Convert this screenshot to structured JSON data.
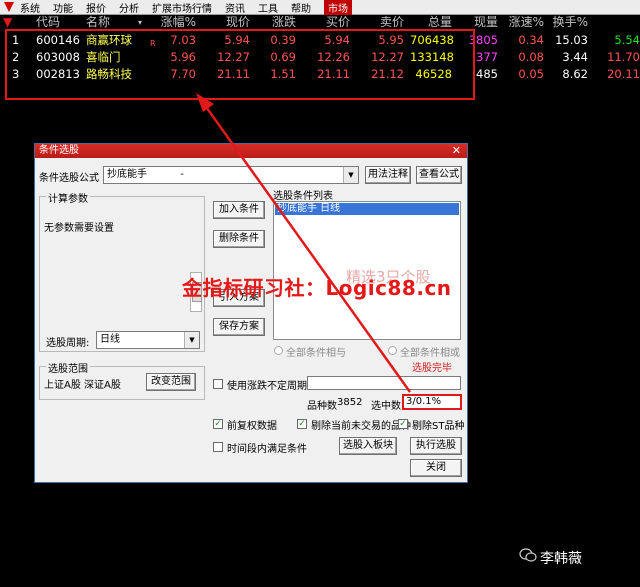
{
  "menubar": {
    "items": [
      "系统",
      "功能",
      "报价",
      "分析",
      "扩展市场行情",
      "资讯",
      "工具",
      "帮助",
      "市场"
    ],
    "active": "市场"
  },
  "quote": {
    "headers": {
      "code": "代码",
      "name": "名称",
      "change_pct": "涨幅%",
      "price": "现价",
      "change": "涨跌",
      "bid": "买价",
      "ask": "卖价",
      "volume": "总量",
      "cur_vol": "现量",
      "speed": "涨速%",
      "turnover": "换手%",
      "extra": ""
    },
    "rows": [
      {
        "idx": "1",
        "code": "600146",
        "name": "商赢环球",
        "flag": "R",
        "change_pct": "7.03",
        "price": "5.94",
        "change": "0.39",
        "bid": "5.94",
        "ask": "5.95",
        "volume": "706438",
        "cur_vol": "3805",
        "speed": "0.34",
        "turnover": "15.03",
        "extra": "5.54"
      },
      {
        "idx": "2",
        "code": "603008",
        "name": "喜临门",
        "flag": "",
        "change_pct": "5.96",
        "price": "12.27",
        "change": "0.69",
        "bid": "12.26",
        "ask": "12.27",
        "volume": "133148",
        "cur_vol": "377",
        "speed": "0.08",
        "turnover": "3.44",
        "extra": "11.70"
      },
      {
        "idx": "3",
        "code": "002813",
        "name": "路畅科技",
        "flag": "",
        "change_pct": "7.70",
        "price": "21.11",
        "change": "1.51",
        "bid": "21.11",
        "ask": "21.12",
        "volume": "46528",
        "cur_vol": "485",
        "speed": "0.05",
        "turnover": "8.62",
        "extra": "20.11"
      }
    ]
  },
  "dialog": {
    "title": "条件选股",
    "formula_label": "条件选股公式",
    "formula_value": "抄底能手",
    "formula_suffix": "-",
    "btn_usage": "用法注释",
    "btn_view_formula": "查看公式",
    "calc_params_title": "计算参数",
    "no_params": "无参数需要设置",
    "period_label": "选股周期:",
    "period_value": "日线",
    "range_title": "选股范围",
    "range_value": "上证A股  深证A股",
    "btn_change_range": "改变范围",
    "btn_add": "加入条件",
    "btn_delete": "删除条件",
    "btn_import": "引入方案",
    "btn_save": "保存方案",
    "list_title": "选股条件列表",
    "list_items": [
      "抄底能手  日线"
    ],
    "radio_and": "全部条件相与",
    "radio_or": "全部条件相或",
    "status": "选股完毕",
    "use_period_label": "使用涨跌不定周期",
    "count_label": "品种数",
    "count_value": "3852",
    "selected_label": "选中数",
    "selected_value": "3/0.1%",
    "chk_restore": "前复权数据",
    "chk_exclude_untraded": "剔除当前未交易的品种",
    "chk_exclude_st": "剔除ST品种",
    "chk_time_cond": "时间段内满足条件",
    "btn_to_block": "选股入板块",
    "btn_execute": "执行选股",
    "btn_close": "关闭"
  },
  "watermark_list": "精选3只个股",
  "overlay_text": "金指标研习社：Logic88.cn",
  "brand": "李韩薇",
  "colors": {
    "accent_red": "#e01a1a",
    "rise_red": "#ff5555",
    "code_white": "#ffffff",
    "name_yellow": "#ffff55",
    "volume_yellow": "#ffff00",
    "purple": "#ff44ff",
    "green": "#22dd22"
  }
}
